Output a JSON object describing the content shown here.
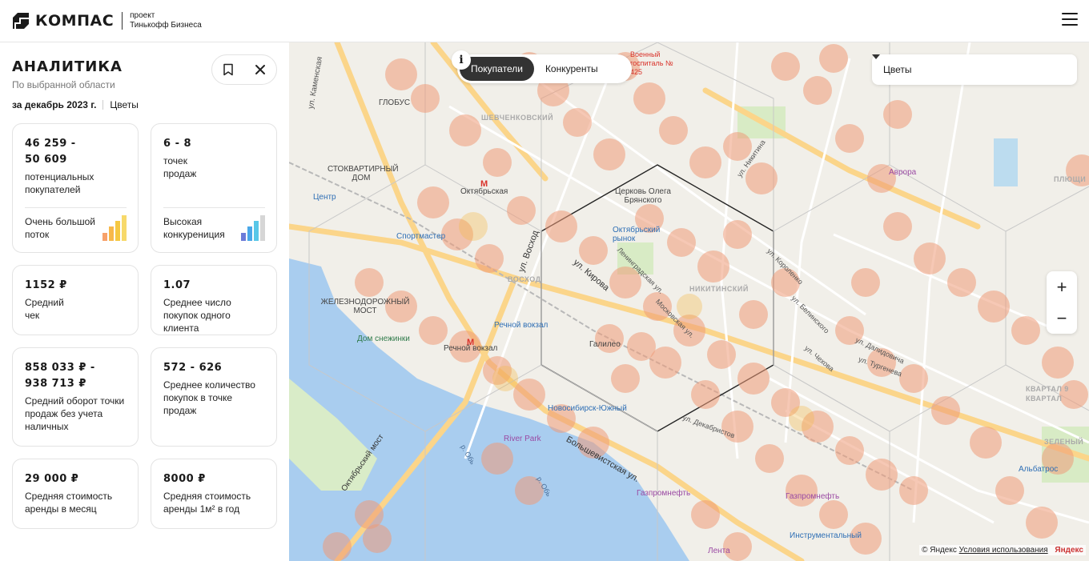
{
  "header": {
    "brand": "КОМПАС",
    "sub_line1": "проект",
    "sub_line2": "Тинькофф Бизнеса",
    "menu_icon": "hamburger-icon"
  },
  "sidebar": {
    "title": "АНАЛИТИКА",
    "subtitle": "По выбранной области",
    "period": "за декабрь 2023 г.",
    "category": "Цветы",
    "bookmark_icon": "bookmark-icon",
    "close_icon": "close-icon",
    "cards": [
      {
        "value_line1": "46 259 -",
        "value_line2": "50 609",
        "label": "потенциальных покупателей",
        "footer": "Очень большой поток",
        "level": "4 of 4",
        "colors": [
          "#f7a16a",
          "#f7b84a",
          "#f5c842",
          "#f7d96a"
        ]
      },
      {
        "value_line1": "6 - 8",
        "value_line2": "",
        "label": "точек продаж",
        "footer": "Высокая конкурениция",
        "level": "3 of 4",
        "colors": [
          "#6c7bd8",
          "#4aa8e8",
          "#58c7e8",
          "#d6d6d6"
        ]
      },
      {
        "value_line1": "1152 ₽",
        "value_line2": "",
        "label": "Средний чек"
      },
      {
        "value_line1": "1.07",
        "value_line2": "",
        "label": "Среднее число покупок одного клиента"
      },
      {
        "value_line1": "858 033 ₽ -",
        "value_line2": "938 713 ₽",
        "label": "Средний оборот точки продаж без учета наличных"
      },
      {
        "value_line1": "572 - 626",
        "value_line2": "",
        "label": "Среднее количество покупок в точке продаж"
      },
      {
        "value_line1": "29 000 ₽",
        "value_line2": "",
        "label": "Средняя стоимость аренды в месяц"
      },
      {
        "value_line1": "8000 ₽",
        "value_line2": "",
        "label": "Средняя стоимость аренды 1м² в год"
      }
    ]
  },
  "map": {
    "tabs": [
      "Покупатели",
      "Конкуренты"
    ],
    "active_tab": "Покупатели",
    "info_icon": "info-icon",
    "select_value": "Цветы",
    "zoom_in": "+",
    "zoom_out": "−",
    "copyright": "© Яндекс",
    "terms": "Условия использования",
    "yandex": "Яндекс",
    "labels": {
      "globus": "ГЛОБУС",
      "shevchenkovsky": "ШЕВЧЕНКОВСКИЙ",
      "stokvartirny": "СТОКВАРТИРНЫЙ ДОМ",
      "oktyabrskaya": "Октябрьская",
      "church": "Церковь Олега Брянского",
      "oktyabrsky_market": "Октябрьский рынок",
      "tsentr": "Центр",
      "sportmaster": "Спортмастер",
      "voskhod": "ВОСХОД",
      "nikitinsky": "НИКИТИНСКИЙ",
      "railway_bridge": "ЖЕЛЕЗНОДОРОЖНЫЙ МОСТ",
      "dom_snezhinki": "Дом снежинки",
      "rechnoy_vokzal": "Речной вокзал",
      "rechnoy_vokzal2": "Речной вокзал",
      "galileo": "Галилео",
      "nsk_south": "Новосибирск-Южный",
      "river_park": "River Park",
      "gazpromneft": "Газпромнефть",
      "gazpromneft2": "Газпромнефть",
      "instrumentalny": "Инструментальный",
      "lenta": "Лента",
      "avrora": "Аврора",
      "albatros": "Альбатрос",
      "hospital": "Военный госпиталь № 425",
      "kvartal": "КВАРТАЛ 9 КВАРТАЛ",
      "zeleny": "ЗЕЛЕНЫЙ",
      "plyushch": "ПЛЮЩИ",
      "ob1": "р. Обь",
      "ob2": "р. Обь",
      "st_kirova": "ул. Кирова",
      "st_voskhod": "ул. Восход",
      "st_bolshevistskaya": "Большевистская ул.",
      "st_oktyabrsky_most": "Октябрьский мост",
      "st_nikitina": "ул. Никитина",
      "st_leningradskaya": "Ленинградская ул.",
      "st_moskovskaya": "Московская ул.",
      "st_dekabristov": "ул. Декабристов",
      "st_chekhova": "ул. Чехова",
      "st_dalidovicha": "ул. Далидовича",
      "st_turgeneva": "ул. Тургенева",
      "st_korolenko": "ул. Короленко",
      "st_belinskogo": "ул. Белинского",
      "st_kamenskaya": "ул. Каменская"
    }
  }
}
